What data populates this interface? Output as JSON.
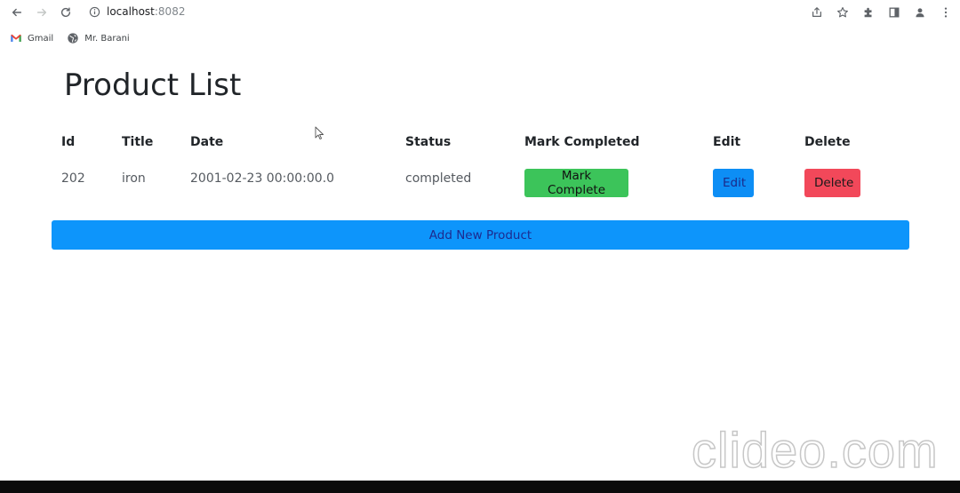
{
  "browser": {
    "url_host": "localhost",
    "url_port": ":8082",
    "bookmarks": [
      {
        "label": "Gmail",
        "icon": "gmail-icon"
      },
      {
        "label": "Mr. Barani",
        "icon": "globe-icon"
      }
    ]
  },
  "page": {
    "title": "Product List",
    "table": {
      "headers": [
        "Id",
        "Title",
        "Date",
        "Status",
        "Mark Completed",
        "Edit",
        "Delete"
      ],
      "rows": [
        {
          "id": "202",
          "title": "iron",
          "date": "2001-02-23 00:00:00.0",
          "status": "completed",
          "mark_label": "Mark Complete",
          "edit_label": "Edit",
          "delete_label": "Delete"
        }
      ]
    },
    "add_button_label": "Add New Product"
  },
  "watermark": "clideo.com",
  "colors": {
    "success": "#3cc45a",
    "primary": "#0d8ef5",
    "danger": "#f2485a",
    "add_button": "#0d95fb"
  }
}
